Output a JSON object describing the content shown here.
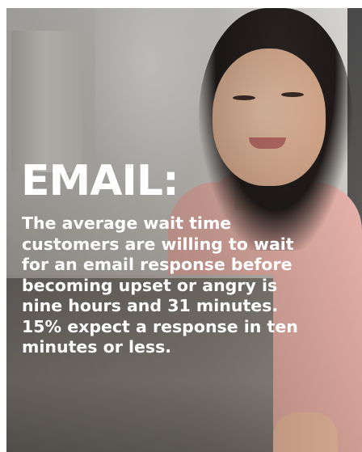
{
  "graphic": {
    "heading": "EMAIL:",
    "body_lines": [
      "The average wait time",
      "customers are willing to wait",
      "for an email response before",
      "becoming upset or angry is",
      "nine hours and 31 minutes.",
      "15% expect a response in ten",
      "minutes or less."
    ]
  },
  "colors": {
    "text": "#ffffff",
    "sweater": "#deaaa1",
    "background": "#ffffff"
  }
}
